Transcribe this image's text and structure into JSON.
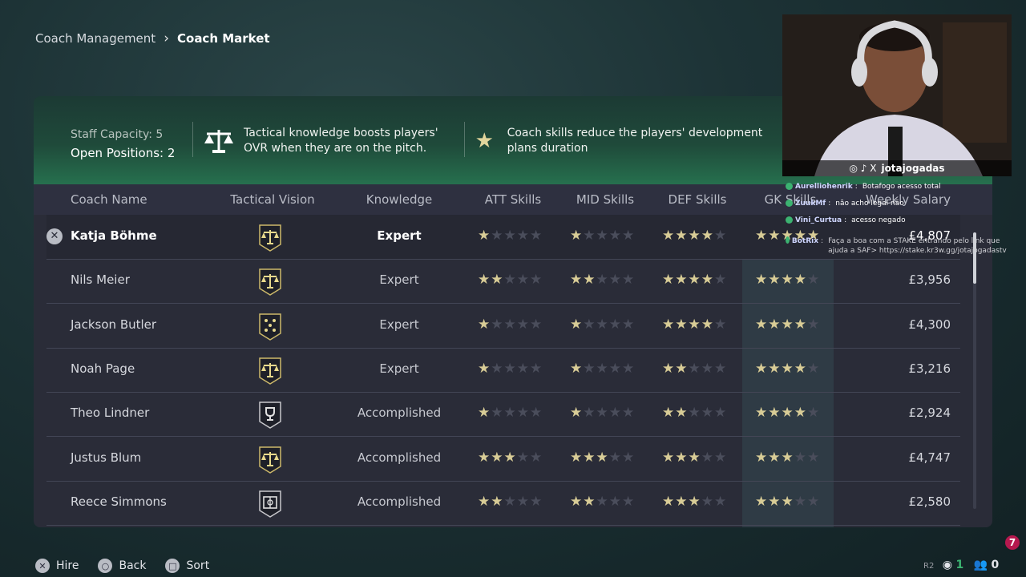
{
  "breadcrumb": {
    "parent": "Coach Management",
    "current": "Coach Market"
  },
  "info": {
    "staff_capacity": "Staff Capacity: 5",
    "open_positions": "Open Positions: 2",
    "tip1": "Tactical knowledge boosts players' OVR when they are on the pitch.",
    "tip2": "Coach skills reduce the players' development plans duration"
  },
  "columns": {
    "name": "Coach Name",
    "vision": "Tactical Vision",
    "knowledge": "Knowledge",
    "att": "ATT Skills",
    "mid": "MID Skills",
    "def": "DEF Skills",
    "gk": "GK Skills",
    "salary": "Weekly Salary"
  },
  "coaches": [
    {
      "name": "Katja Böhme",
      "vision_icon": "scales-icon",
      "knowledge": "Expert",
      "att": 1,
      "mid": 1,
      "def": 4,
      "gk": 5,
      "salary": "£4,807",
      "selected": true
    },
    {
      "name": "Nils Meier",
      "vision_icon": "scales-icon",
      "knowledge": "Expert",
      "att": 2,
      "mid": 2,
      "def": 4,
      "gk": 4,
      "salary": "£3,956"
    },
    {
      "name": "Jackson Butler",
      "vision_icon": "formation-icon",
      "knowledge": "Expert",
      "att": 1,
      "mid": 1,
      "def": 4,
      "gk": 4,
      "salary": "£4,300"
    },
    {
      "name": "Noah Page",
      "vision_icon": "scales-icon",
      "knowledge": "Expert",
      "att": 1,
      "mid": 1,
      "def": 2,
      "gk": 4,
      "salary": "£3,216"
    },
    {
      "name": "Theo Lindner",
      "vision_icon": "trophy-icon",
      "knowledge": "Accomplished",
      "att": 1,
      "mid": 1,
      "def": 2,
      "gk": 4,
      "salary": "£2,924"
    },
    {
      "name": "Justus Blum",
      "vision_icon": "scales-icon",
      "knowledge": "Accomplished",
      "att": 3,
      "mid": 3,
      "def": 3,
      "gk": 3,
      "salary": "£4,747"
    },
    {
      "name": "Reece Simmons",
      "vision_icon": "pitch-icon",
      "knowledge": "Accomplished",
      "att": 2,
      "mid": 2,
      "def": 3,
      "gk": 3,
      "salary": "£2,580"
    }
  ],
  "footer": {
    "hire": "Hire",
    "back": "Back",
    "sort": "Sort"
  },
  "overlay": {
    "handle": "jotajogadas",
    "chat": [
      {
        "user": "Aurelliohenrik",
        "msg": "Botafogo acesso total"
      },
      {
        "user": "ZuukMf",
        "msg": "não acho legal não"
      },
      {
        "user": "Vini_Curtua",
        "msg": "acesso negado"
      },
      {
        "user": "BotRix",
        "msg": "Faça a boa com a STAKE entrando pelo link que ajuda a SAF> https://stake.kr3w.gg/jotajogadastv"
      }
    ],
    "viewers": "1",
    "followers": "0",
    "notification": "7"
  },
  "colors": {
    "star_on": "#d8cc96",
    "star_off": "#4a4d5b",
    "accent": "#26704e"
  }
}
